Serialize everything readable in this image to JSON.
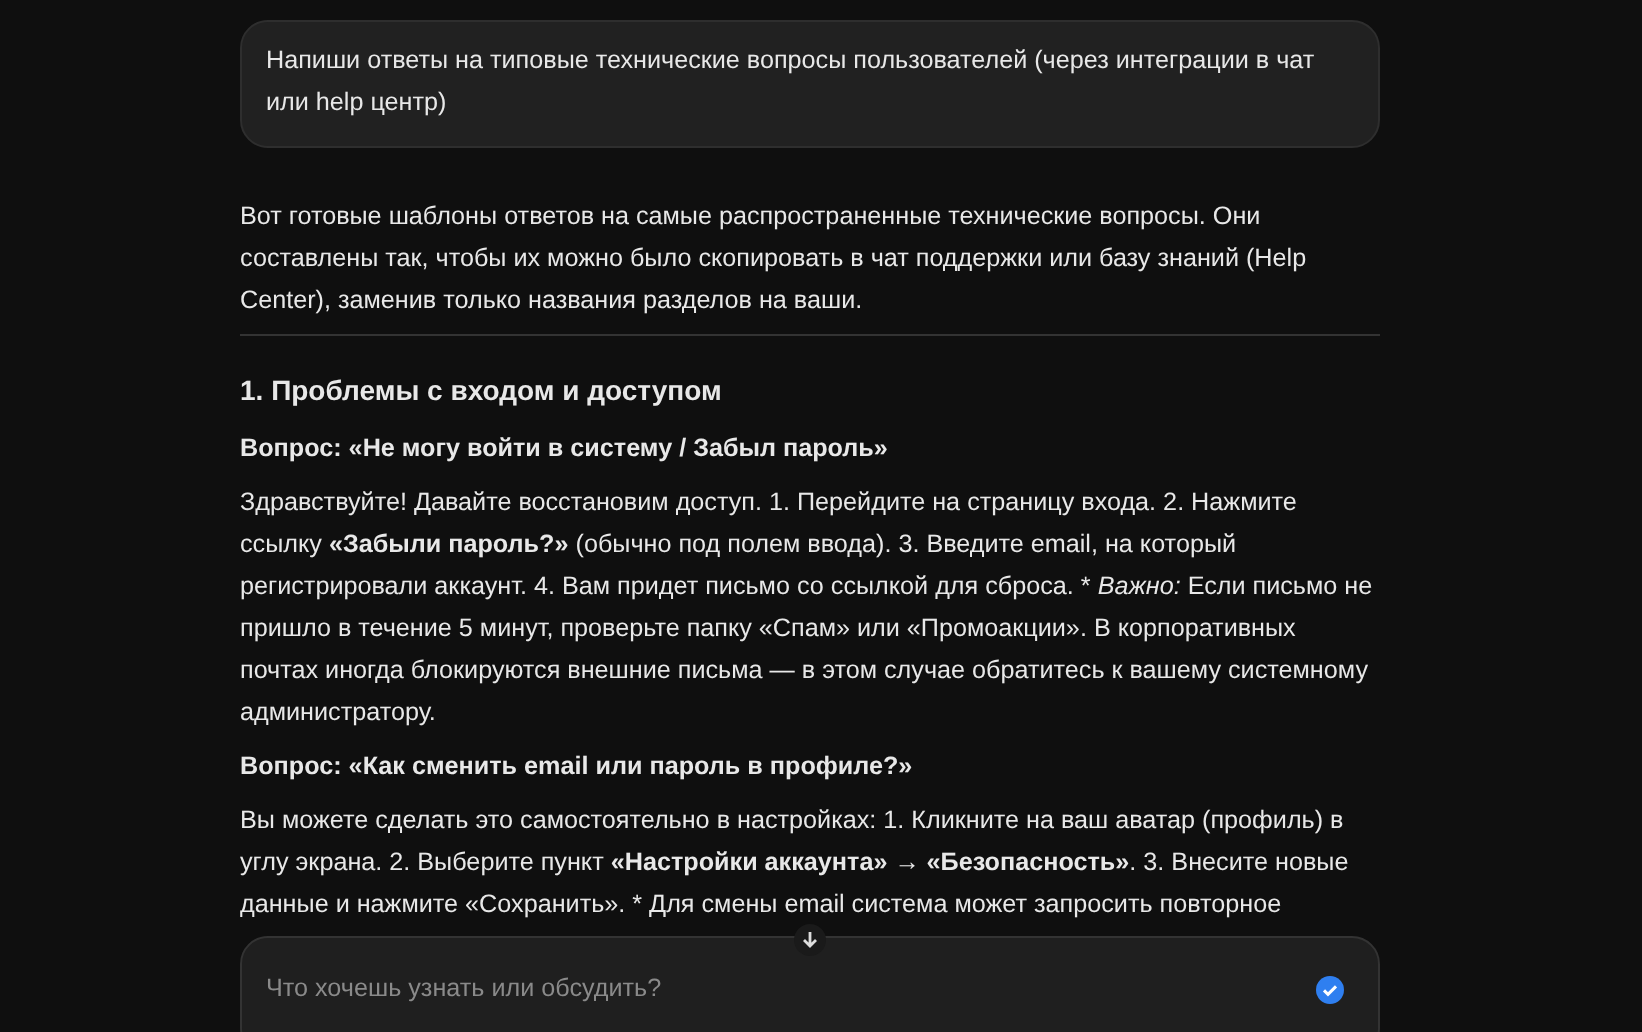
{
  "user_message": {
    "text": "Напиши ответы на типовые технические вопросы пользователей (через интеграции в чат или help центр)"
  },
  "response": {
    "intro": "Вот готовые шаблоны ответов на самые распространенные технические вопросы. Они составлены так, чтобы их можно было скопировать в чат поддержки или базу знаний (Help Center), заменив только названия разделов на ваши.",
    "sections": [
      {
        "heading": "1. Проблемы с входом и доступом",
        "items": [
          {
            "question": "Вопрос: «Не могу войти в систему / Забыл пароль»",
            "answer": "Здравствуйте! Давайте восстановим доступ. 1. Перейдите на страницу входа. 2. Нажмите ссылку **«Забыли пароль?»** (обычно под полем ввода). 3. Введите email, на который регистрировали аккаунт. 4. Вам придет письмо со ссылкой для сброса. * *Важно:* Если письмо не пришло в течение 5 минут, проверьте папку «Спам» или «Промоакции». В корпоративных почтах иногда блокируются внешние письма — в этом случае обратитесь к вашему системному администратору."
          },
          {
            "question": "Вопрос: «Как сменить email или пароль в профиле?»",
            "answer": "Вы можете сделать это самостоятельно в настройках: 1. Кликните на ваш аватар (профиль) в углу экрана. 2. Выберите пункт **«Настройки аккаунта» → «Безопасность»**. 3. Внесите новые данные и нажмите «Сохранить». * Для смены email система может запросить повторное"
          }
        ]
      }
    ]
  },
  "composer": {
    "placeholder": "Что хочешь узнать или обсудить?"
  }
}
